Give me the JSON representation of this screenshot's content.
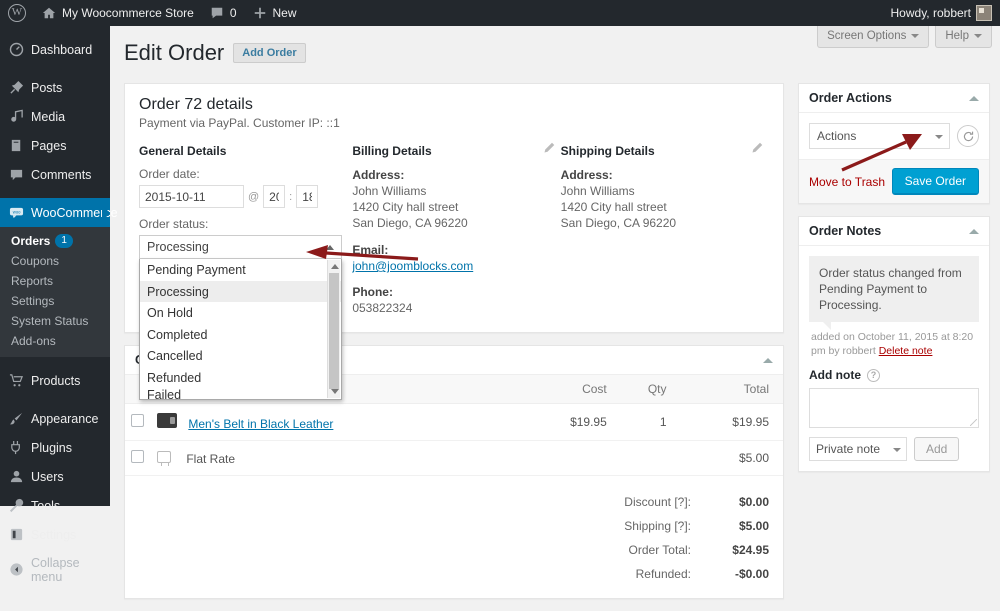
{
  "adminbar": {
    "site_name": "My Woocommerce Store",
    "comments_count": "0",
    "new_label": "New",
    "howdy": "Howdy, robbert",
    "wp_logo_icon": "wordpress-logo-icon",
    "home_icon": "home-icon",
    "comment_icon": "comment-bubble-icon",
    "plus_icon": "plus-icon",
    "avatar_icon": "user-avatar"
  },
  "sidebar": {
    "items": [
      {
        "label": "Dashboard",
        "icon": "dashboard-icon"
      },
      {
        "label": "Posts",
        "icon": "pin-icon"
      },
      {
        "label": "Media",
        "icon": "media-icon"
      },
      {
        "label": "Pages",
        "icon": "page-icon"
      },
      {
        "label": "Comments",
        "icon": "comment-bubble-icon"
      },
      {
        "label": "WooCommerce",
        "icon": "woocommerce-icon",
        "current": true
      },
      {
        "label": "Products",
        "icon": "cart-icon"
      },
      {
        "label": "Appearance",
        "icon": "brush-icon"
      },
      {
        "label": "Plugins",
        "icon": "plug-icon"
      },
      {
        "label": "Users",
        "icon": "users-icon"
      },
      {
        "label": "Tools",
        "icon": "wrench-icon"
      },
      {
        "label": "Settings",
        "icon": "settings-icon"
      }
    ],
    "submenu": [
      {
        "label": "Orders",
        "badge": "1",
        "current": true
      },
      {
        "label": "Coupons"
      },
      {
        "label": "Reports"
      },
      {
        "label": "Settings"
      },
      {
        "label": "System Status"
      },
      {
        "label": "Add-ons"
      }
    ],
    "collapse_label": "Collapse menu",
    "collapse_icon": "collapse-arrow-icon",
    "accent_color": "#0073aa"
  },
  "screen_meta": {
    "screen_options": "Screen Options",
    "help": "Help"
  },
  "header": {
    "title": "Edit Order",
    "add_button": "Add Order"
  },
  "order_details": {
    "panel_title": "Order 72 details",
    "subtitle": "Payment via PayPal. Customer IP: ::1",
    "general": {
      "heading": "General Details",
      "order_date_label": "Order date:",
      "order_date": "2015-10-11",
      "at_symbol": "@",
      "hour": "20",
      "minute_sep": ":",
      "minute": "18",
      "order_status_label": "Order status:",
      "selected_status": "Processing",
      "status_options": [
        "Pending Payment",
        "Processing",
        "On Hold",
        "Completed",
        "Cancelled",
        "Refunded",
        "Failed"
      ]
    },
    "billing": {
      "heading": "Billing Details",
      "address_label": "Address:",
      "name": "John Williams",
      "street": "1420 City hall street",
      "city": "San Diego, CA 96220",
      "email_label": "Email:",
      "email": "john@joomblocks.com",
      "phone_label": "Phone:",
      "phone": "053822324",
      "edit_icon": "pencil-icon"
    },
    "shipping": {
      "heading": "Shipping Details",
      "address_label": "Address:",
      "name": "John Williams",
      "street": "1420 City hall street",
      "city": "San Diego, CA 96220",
      "edit_icon": "pencil-icon"
    }
  },
  "items_panel": {
    "title": "Order Items",
    "columns": [
      "Cost",
      "Qty",
      "Total"
    ],
    "rows": [
      {
        "name": "Men's Belt in Black Leather",
        "cost": "$19.95",
        "qty": "1",
        "total": "$19.95",
        "icon": "product-thumbnail"
      },
      {
        "name": "Flat Rate",
        "cost": "",
        "qty": "",
        "total": "$5.00",
        "icon": "shipping-icon"
      }
    ],
    "totals": [
      {
        "label": "Discount [?]:",
        "value": "$0.00"
      },
      {
        "label": "Shipping [?]:",
        "value": "$5.00"
      },
      {
        "label": "Order Total:",
        "value": "$24.95"
      },
      {
        "label": "Refunded:",
        "value": "-$0.00",
        "color": "#aa0000"
      }
    ]
  },
  "order_actions": {
    "title": "Order Actions",
    "select_value": "Actions",
    "refresh_icon": "refresh-icon",
    "trash_label": "Move to Trash",
    "save_label": "Save Order",
    "save_color": "#00a0d2"
  },
  "order_notes": {
    "title": "Order Notes",
    "notes": [
      {
        "text": "Order status changed from Pending Payment to Processing.",
        "meta_prefix": "added on October 11, 2015 at 8:20 pm by robbert",
        "delete_label": "Delete note"
      }
    ],
    "add_note_label": "Add note",
    "help_icon": "help-icon",
    "textarea_value": "",
    "note_type": "Private note",
    "add_button": "Add"
  },
  "annotations": {
    "arrow_color": "#8b1a1a",
    "arrow_status": "arrow-pointing-to-processing-option",
    "arrow_save": "arrow-pointing-to-save-order-button"
  }
}
